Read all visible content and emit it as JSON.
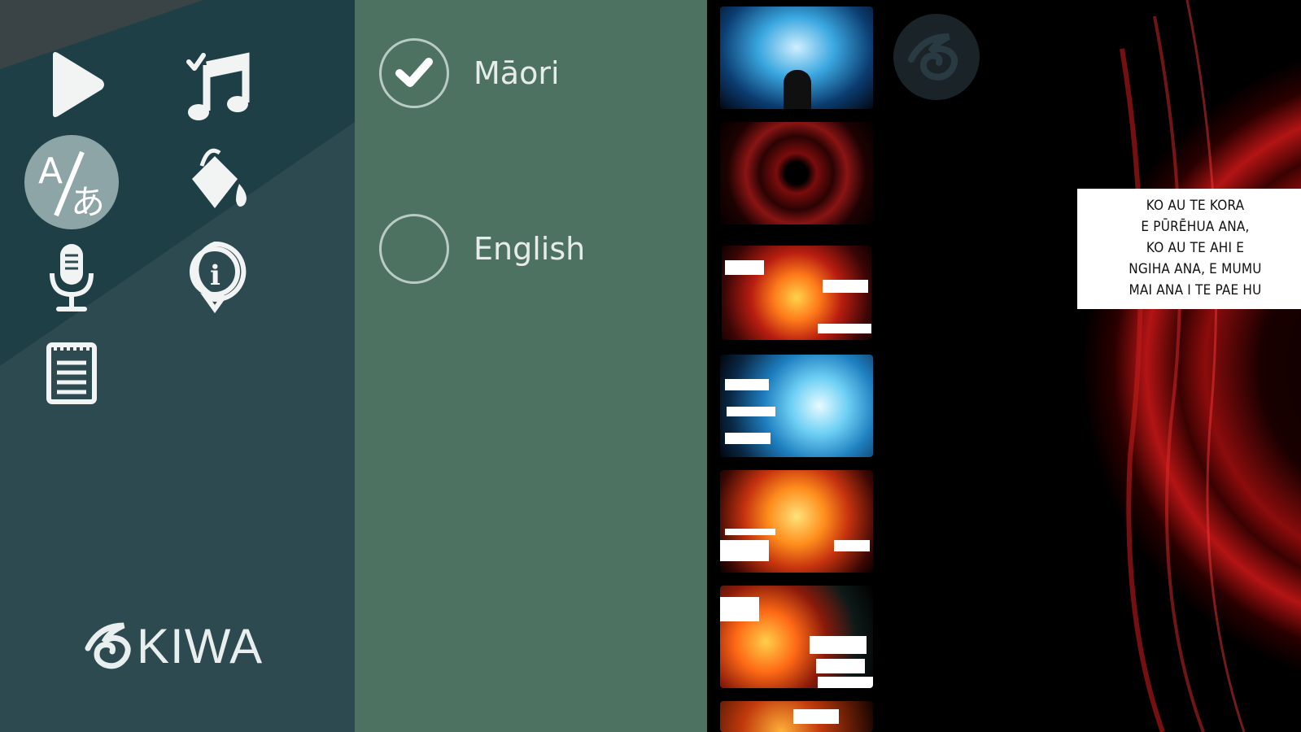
{
  "menu": {
    "items": [
      {
        "name": "play-icon"
      },
      {
        "name": "music-icon"
      },
      {
        "name": "translate-icon",
        "active": true
      },
      {
        "name": "paint-bucket-icon"
      },
      {
        "name": "microphone-icon"
      },
      {
        "name": "info-icon"
      },
      {
        "name": "notepad-icon"
      }
    ],
    "logo_text": "KIWA"
  },
  "language": {
    "options": [
      {
        "label": "Māori",
        "selected": true
      },
      {
        "label": "English",
        "selected": false
      }
    ]
  },
  "thumbnails": {
    "count": 7,
    "selected_index": 2
  },
  "viewer": {
    "eye_button": "eye-swirl-icon",
    "speech_lines": [
      "KO AU TE KORA",
      "E PŪRĒHUA ANA,",
      "KO AU TE AHI E",
      "NGIHA ANA, E MUMU",
      "MAI ANA I TE PAE HU"
    ]
  },
  "colors": {
    "menu_bg": "#2c4a4f",
    "language_bg": "#4d7262",
    "viewer_bg": "#000000"
  }
}
